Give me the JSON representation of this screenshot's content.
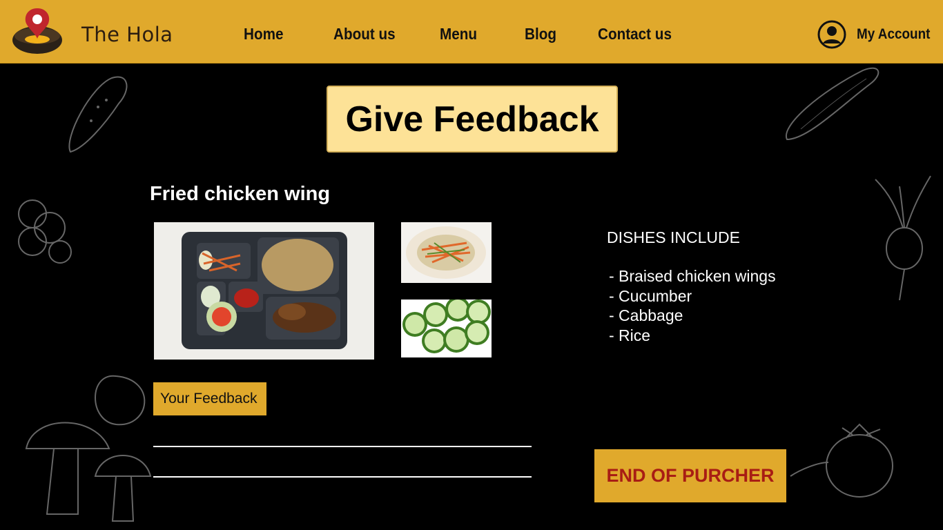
{
  "header": {
    "brand": "The Hola",
    "nav": [
      {
        "label": "Home"
      },
      {
        "label": "About us"
      },
      {
        "label": "Menu"
      },
      {
        "label": "Blog"
      },
      {
        "label": "Contact us"
      }
    ],
    "account_label": "My Account",
    "account_icon": "user-circle-icon",
    "logo_icon": "map-pin-bowl-logo"
  },
  "page": {
    "title": "Give Feedback",
    "dish_name": "Fried chicken wing",
    "dishes_heading": "DISHES INCLUDE",
    "dishes": [
      "- Braised chicken wings",
      "- Cucumber",
      "- Cabbage",
      "- Rice"
    ],
    "feedback_label": "Your Feedback",
    "end_button": "END OF PURCHER"
  },
  "colors": {
    "header_bg": "#e0a92c",
    "title_bg": "#fde297",
    "button_text": "#a81d14",
    "background": "#000000"
  }
}
